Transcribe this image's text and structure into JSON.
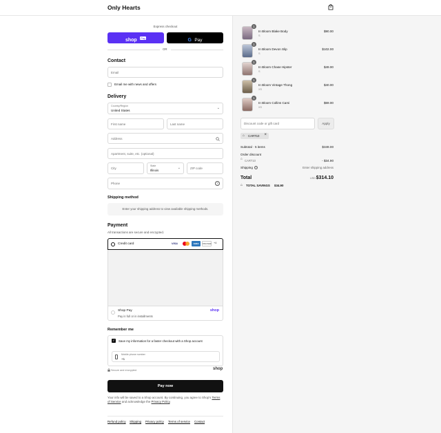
{
  "header": {
    "brand": "Only Hearts",
    "bag_icon": "shopping-bag-icon"
  },
  "express": {
    "label": "Express checkout",
    "shop_pay_label": "shop",
    "shop_pay_badge": "Pay",
    "google_pay_label": "Pay",
    "or_label": "OR"
  },
  "contact": {
    "title": "Contact",
    "email_placeholder": "Email",
    "newsletter_label": "Email me with news and offers"
  },
  "delivery": {
    "title": "Delivery",
    "country_label": "Country/Region",
    "country_value": "United States",
    "first_name_placeholder": "First name",
    "last_name_placeholder": "Last name",
    "address_placeholder": "Address",
    "apartment_placeholder": "Apartment, suite, etc. (optional)",
    "city_placeholder": "City",
    "state_label": "State",
    "state_value": "Illinois",
    "zip_placeholder": "ZIP code",
    "phone_placeholder": "Phone"
  },
  "shipping_method": {
    "title": "Shipping method",
    "message": "Enter your shipping address to view available shipping methods."
  },
  "payment": {
    "title": "Payment",
    "subtitle": "All transactions are secure and encrypted.",
    "credit_card_label": "Credit card",
    "card_brands": [
      "VISA",
      "MC",
      "AMEX",
      "DISCOVER",
      "+4"
    ],
    "shop_pay_title": "Shop Pay",
    "shop_pay_subtitle": "Pay in full or in installments",
    "shop_pay_logo": "shop"
  },
  "remember_me": {
    "title": "Remember me",
    "checkbox_label": "Save my information for a faster checkout with a Shop account",
    "phone_label": "Mobile phone number",
    "phone_value": "+1",
    "secure_label": "Secure and encrypted",
    "shop_logo": "shop"
  },
  "pay_now_label": "Pay now",
  "legal": {
    "text_prefix": "Your info will be saved to a Shop account. By continuing, you agree to Shop's",
    "terms": "Terms of Service",
    "and_text": "and acknowledge the",
    "privacy": "Privacy Policy",
    "end": "."
  },
  "footer_links": [
    "Refund policy",
    "Shipping",
    "Privacy policy",
    "Terms of service",
    "Contact"
  ],
  "cart": {
    "items": [
      {
        "qty": "1",
        "name": "In Bloom Blake Body",
        "variant": "S",
        "price": "$90.00"
      },
      {
        "qty": "1",
        "name": "In Bloom Devon Slip",
        "variant": "S",
        "price": "$102.00"
      },
      {
        "qty": "1",
        "name": "In Bloom Chase Hipster",
        "variant": "S",
        "price": "$49.00"
      },
      {
        "qty": "1",
        "name": "In Bloom Vintage Thong",
        "variant": "XS",
        "price": "$40.00"
      },
      {
        "qty": "1",
        "name": "In Bloom Collins Cami",
        "variant": "XS",
        "price": "$69.00"
      }
    ],
    "discount_placeholder": "Discount code or gift card",
    "apply_label": "Apply",
    "applied_code": "CART10",
    "subtotal_label": "Subtotal · 5 items",
    "subtotal_value": "$349.00",
    "order_discount_label": "Order discount",
    "order_discount_code": "CART10",
    "order_discount_value": "- $34.90",
    "shipping_label": "Shipping",
    "shipping_value": "Enter shipping address",
    "total_label": "Total",
    "currency": "USD",
    "total_value": "$314.10",
    "savings_label": "TOTAL SAVINGS",
    "savings_value": "$34.90"
  }
}
